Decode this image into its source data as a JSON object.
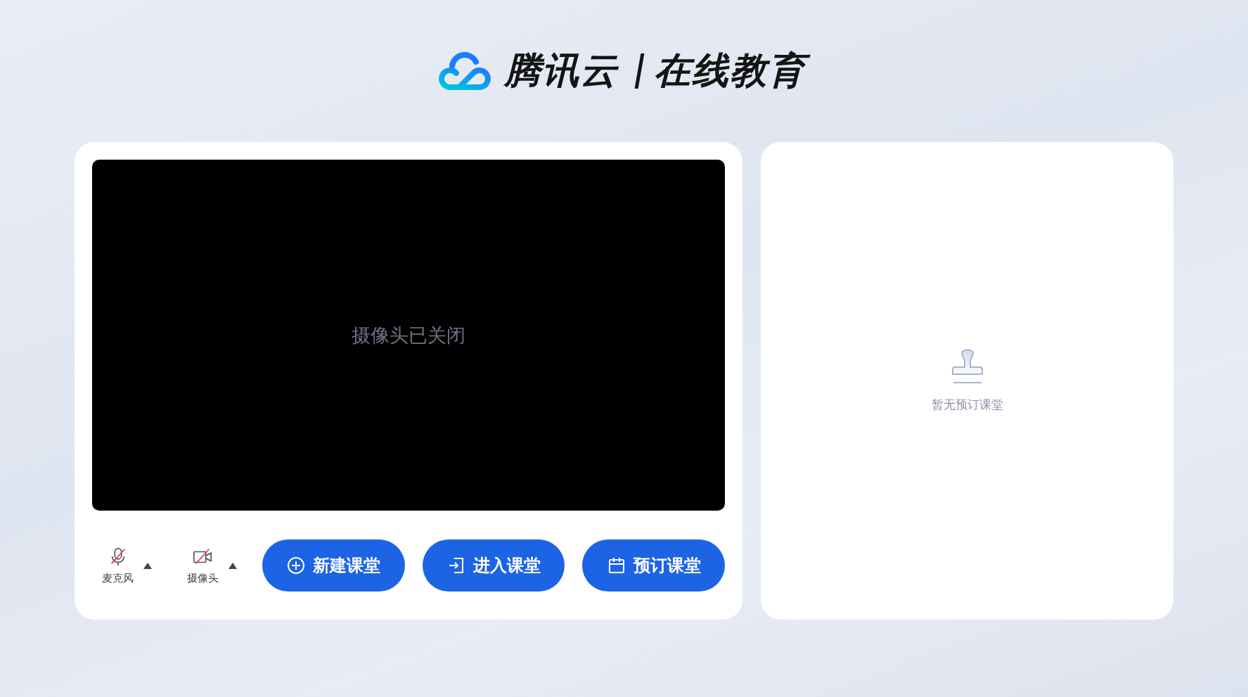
{
  "header": {
    "brand": "腾讯云",
    "product": "在线教育"
  },
  "preview": {
    "message": "摄像头已关闭",
    "camera_on": false
  },
  "devices": [
    {
      "kind": "mic",
      "label": "麦克风",
      "on": false
    },
    {
      "kind": "camera",
      "label": "摄像头",
      "on": false
    }
  ],
  "actions": [
    {
      "kind": "create",
      "label": "新建课堂"
    },
    {
      "kind": "join",
      "label": "进入课堂"
    },
    {
      "kind": "schedule",
      "label": "预订课堂"
    }
  ],
  "schedule_panel": {
    "empty_message": "暂无预订课堂"
  }
}
